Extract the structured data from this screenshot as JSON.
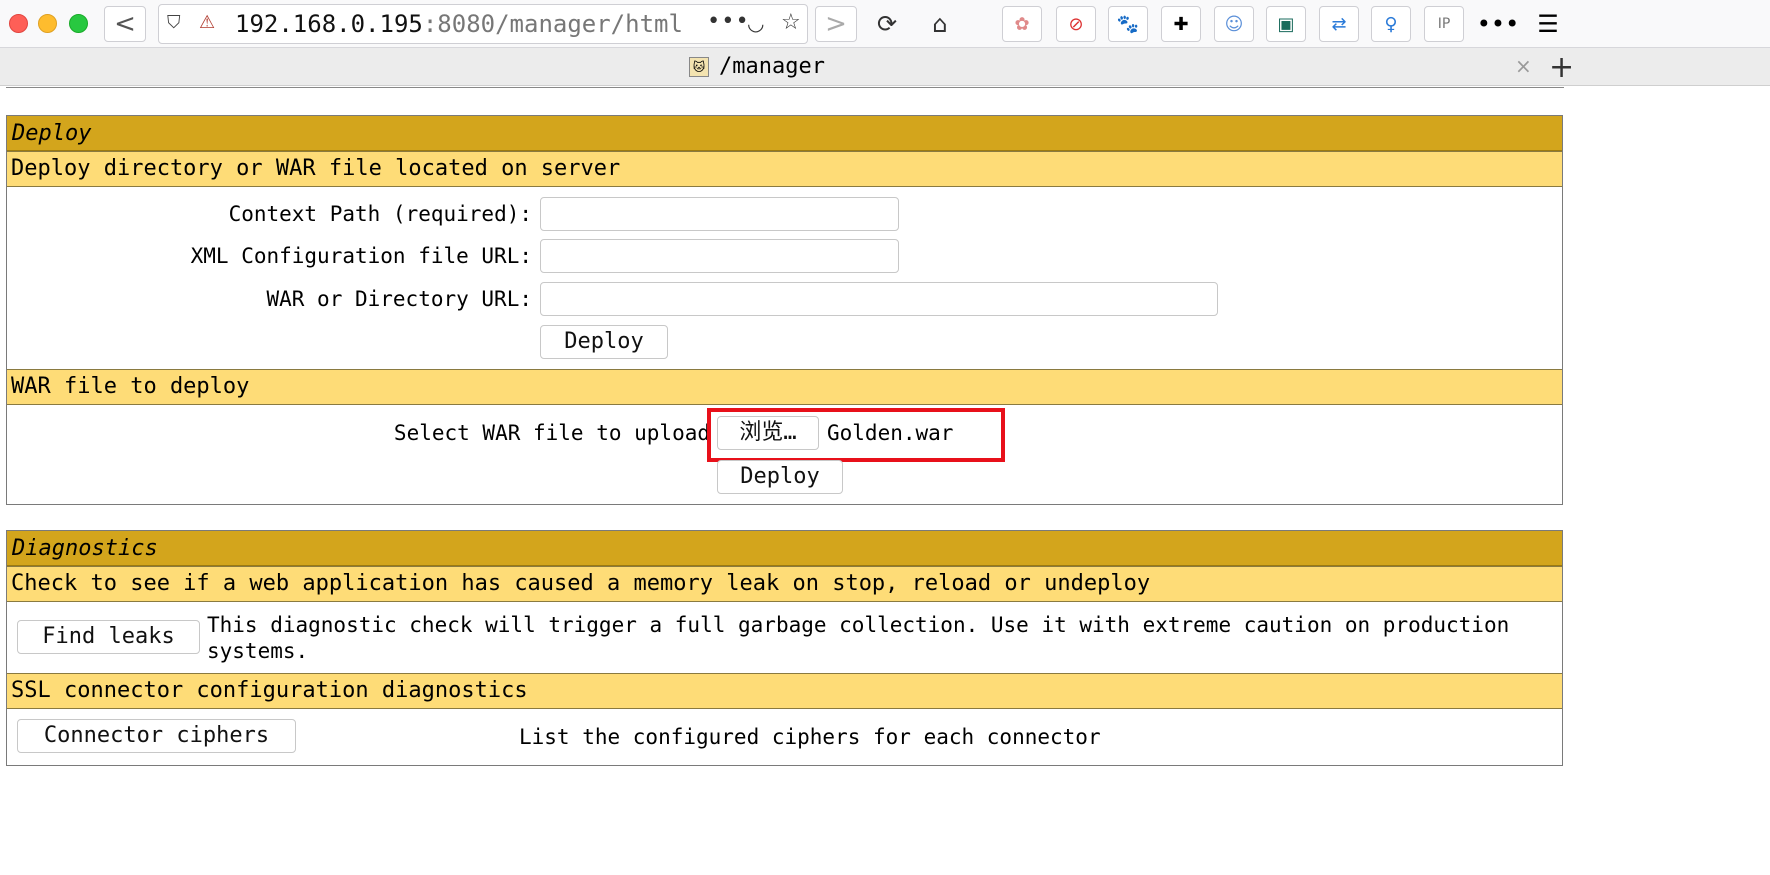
{
  "browser": {
    "url_host": "192.168.0.195",
    "url_path": ":8080/manager/html",
    "url_more": "•••",
    "tab_title": "/manager",
    "tab_close": "×",
    "tab_new": "+",
    "nav": {
      "back": "<",
      "forward": ">",
      "reload": "⟳",
      "home": "⌂"
    },
    "extension_icons": [
      "pocket-like-icon",
      "blocker-icon",
      "gnome-icon",
      "puzzle-icon",
      "anime-avatar-icon",
      "terminal-icon",
      "repeat-icon",
      "pin-icon",
      "ip-icon",
      "more-icon",
      "hamburger-menu-icon"
    ]
  },
  "deploy": {
    "header": "Deploy",
    "server_subheader": "Deploy directory or WAR file located on server",
    "context_path_label": "Context Path (required):",
    "xml_config_label": "XML Configuration file URL:",
    "war_dir_label": "WAR or Directory URL:",
    "deploy_button": "Deploy",
    "war_subheader": "WAR file to deploy",
    "select_war_label": "Select WAR file to upload",
    "browse_button": "浏览…",
    "selected_file": "Golden.war",
    "upload_deploy_button": "Deploy"
  },
  "diagnostics": {
    "header": "Diagnostics",
    "leak_subheader": "Check to see if a web application has caused a memory leak on stop, reload or undeploy",
    "find_leaks_button": "Find leaks",
    "find_leaks_desc_line1": "This diagnostic check will trigger a full garbage collection. Use it with extreme caution on production",
    "find_leaks_desc_line2": "systems.",
    "ssl_subheader": "SSL connector configuration diagnostics",
    "connector_ciphers_button": "Connector ciphers",
    "connector_ciphers_desc": "List the configured ciphers for each connector"
  },
  "colors": {
    "section_header": "#d3a51c",
    "section_subheader": "#fedc77",
    "highlight_box": "#e8101a"
  }
}
